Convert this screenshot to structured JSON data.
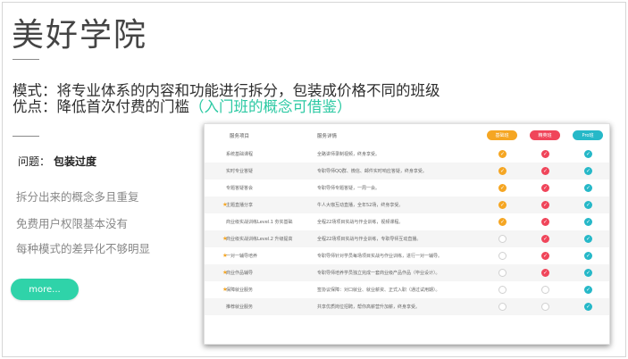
{
  "title": "美好学院",
  "mode_line": "模式：将专业体系的内容和功能进行拆分，包装成价格不同的班级",
  "advantage_line_prefix": "优点：降低首次付费的门槛",
  "advantage_line_highlight": "（入门班的概念可借鉴）",
  "question_label": "问题：",
  "question_value": "包装过度",
  "issues": [
    "拆分出来的概念多且重复",
    "免费用户权限基本没有",
    "每种模式的差异化不够明显"
  ],
  "more_button": "more...",
  "colors": {
    "accent": "#2fd3a9",
    "tier_basic": "#f5a623",
    "tier_elite": "#f0455a",
    "tier_pro": "#26b8c8"
  },
  "table": {
    "headers": {
      "service_item": "服务项目",
      "service_detail": "服务详情"
    },
    "tiers": [
      "基础班",
      "精英班",
      "Pro班"
    ],
    "rows": [
      {
        "starred": false,
        "name": "系统基础课程",
        "detail": "全路讲师录制视频，终身享受。",
        "marks": [
          true,
          true,
          true
        ]
      },
      {
        "starred": false,
        "name": "实时专业答疑",
        "detail": "专职导师QQ群、微信、邮件实时响应答疑，终身享受。",
        "marks": [
          true,
          true,
          true
        ]
      },
      {
        "starred": false,
        "name": "专题答疑答会",
        "detail": "专职导师专题答疑，一周一会。",
        "marks": [
          true,
          true,
          true
        ]
      },
      {
        "starred": true,
        "name": "主题直播分享",
        "detail": "牛人大咖互动直播，全年52场，终身享受。",
        "marks": [
          true,
          true,
          true
        ]
      },
      {
        "starred": false,
        "name": "商业级实战训练Level.1 夯实基础",
        "detail": "全程22场项目实战与作业训练，视频课程。",
        "marks": [
          true,
          true,
          true
        ]
      },
      {
        "starred": true,
        "name": "商业级实战训练Level.2 升级提高",
        "detail": "全程22场项目实战与作业训练，专职导师互动直播。",
        "marks": [
          false,
          true,
          true
        ]
      },
      {
        "starred": true,
        "name": "一对一辅导培养",
        "detail": "专职导师针对学员每场项目实战与作业训练，进行一对一辅导。",
        "marks": [
          false,
          true,
          true
        ]
      },
      {
        "starred": true,
        "name": "商业作品辅导",
        "detail": "专职导师培养学员独立完成一套商业级产品作品（毕业设计）。",
        "marks": [
          false,
          true,
          true
        ]
      },
      {
        "starred": true,
        "name": "保障就业服务",
        "detail": "签协议保障：对口就业、就业薪资、正式入职（通过试用期）。",
        "marks": [
          false,
          false,
          true
        ]
      },
      {
        "starred": false,
        "name": "推荐就业服务",
        "detail": "共享优质岗位招聘，帮你高薪营升加薪，终身享受。",
        "marks": [
          false,
          false,
          true
        ]
      }
    ]
  }
}
